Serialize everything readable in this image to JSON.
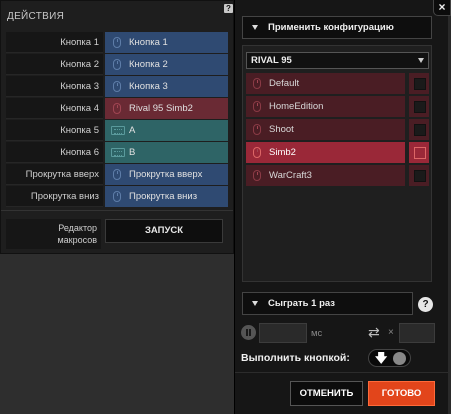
{
  "left": {
    "title": "ДЕЙСТВИЯ",
    "help": "?",
    "rows": [
      {
        "label": "Кнопка 1",
        "value": "Кнопка 1",
        "kind": "mouse",
        "icon": "mouse-icon"
      },
      {
        "label": "Кнопка 2",
        "value": "Кнопка 2",
        "kind": "mouse",
        "icon": "mouse-icon"
      },
      {
        "label": "Кнопка 3",
        "value": "Кнопка 3",
        "kind": "mouse",
        "icon": "mouse-icon"
      },
      {
        "label": "Кнопка 4",
        "value": "Rival 95 Simb2",
        "kind": "macro",
        "icon": "mouse-icon"
      },
      {
        "label": "Кнопка 5",
        "value": "A",
        "kind": "key",
        "icon": "keyboard-icon"
      },
      {
        "label": "Кнопка 6",
        "value": "B",
        "kind": "key",
        "icon": "keyboard-icon"
      },
      {
        "label": "Прокрутка вверх",
        "value": "Прокрутка вверх",
        "kind": "mouse",
        "icon": "mouse-icon"
      },
      {
        "label": "Прокрутка вниз",
        "value": "Прокрутка вниз",
        "kind": "mouse",
        "icon": "mouse-icon"
      }
    ],
    "editor_label_1": "Редактор",
    "editor_label_2": "макросов",
    "launch_button": "ЗАПУСК"
  },
  "right": {
    "close": "×",
    "apply_dropdown": "Применить конфигурацию",
    "profile_dropdown": "RIVAL 95",
    "configs": [
      {
        "name": "Default",
        "active": false
      },
      {
        "name": "HomeEdition",
        "active": false
      },
      {
        "name": "Shoot",
        "active": false
      },
      {
        "name": "Simb2",
        "active": true
      },
      {
        "name": "WarCraft3",
        "active": false
      }
    ],
    "play_dropdown": "Сыграть 1 раз",
    "help": "?",
    "delay_value": "",
    "delay_unit": "мс",
    "repeat_x": "×",
    "repeat_value": "",
    "exec_label": "Выполнить кнопкой:",
    "exec_arrow": "🡇",
    "cancel_button": "ОТМЕНИТЬ",
    "done_button": "ГОТОВО"
  },
  "colors": {
    "mouse": "#2f4a72",
    "macro": "#6a2a34",
    "key": "#2e6466",
    "config_active": "#9a2838",
    "config_inactive": "#4a1d24",
    "done": "#e2451b"
  }
}
